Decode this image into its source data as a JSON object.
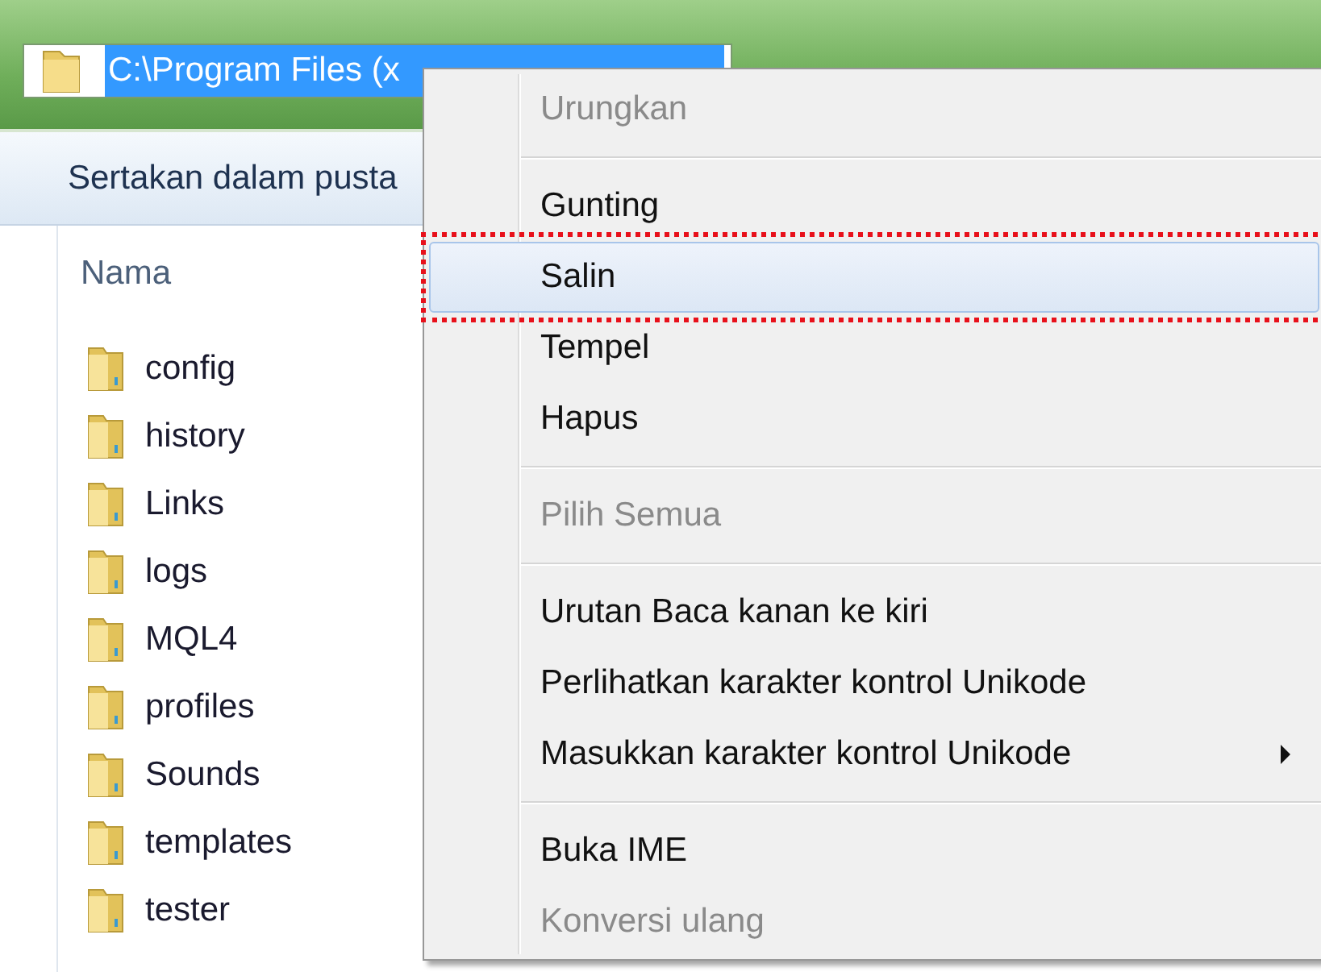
{
  "address_bar": {
    "path": "C:\\Program Files (x",
    "selected": true
  },
  "toolbar": {
    "items": [
      "Sertakan dalam pusta"
    ]
  },
  "file_list": {
    "columns": [
      "Nama"
    ],
    "rows": [
      {
        "name": "config",
        "kind": "folder"
      },
      {
        "name": "history",
        "kind": "folder"
      },
      {
        "name": "Links",
        "kind": "folder"
      },
      {
        "name": "logs",
        "kind": "folder"
      },
      {
        "name": "MQL4",
        "kind": "folder"
      },
      {
        "name": "profiles",
        "kind": "folder"
      },
      {
        "name": "Sounds",
        "kind": "folder"
      },
      {
        "name": "templates",
        "kind": "folder"
      },
      {
        "name": "tester",
        "kind": "folder"
      }
    ]
  },
  "context_menu": {
    "items": [
      {
        "kind": "item",
        "label": "Urungkan",
        "disabled": true,
        "selected": false
      },
      {
        "kind": "separator"
      },
      {
        "kind": "item",
        "label": "Gunting",
        "disabled": false,
        "selected": false
      },
      {
        "kind": "item",
        "label": "Salin",
        "disabled": false,
        "selected": true,
        "outlined": true
      },
      {
        "kind": "item",
        "label": "Tempel",
        "disabled": false,
        "selected": false
      },
      {
        "kind": "item",
        "label": "Hapus",
        "disabled": false,
        "selected": false
      },
      {
        "kind": "separator"
      },
      {
        "kind": "item",
        "label": "Pilih Semua",
        "disabled": true,
        "selected": false
      },
      {
        "kind": "separator"
      },
      {
        "kind": "item",
        "label": "Urutan Baca kanan ke kiri",
        "disabled": false,
        "selected": false
      },
      {
        "kind": "item",
        "label": "Perlihatkan karakter kontrol Unikode",
        "disabled": false,
        "selected": false
      },
      {
        "kind": "item",
        "label": "Masukkan karakter kontrol Unikode",
        "disabled": false,
        "selected": false,
        "submenu": true
      },
      {
        "kind": "separator"
      },
      {
        "kind": "item",
        "label": "Buka IME",
        "disabled": false,
        "selected": false
      },
      {
        "kind": "item",
        "label": "Konversi ulang",
        "disabled": true,
        "selected": false
      }
    ]
  }
}
